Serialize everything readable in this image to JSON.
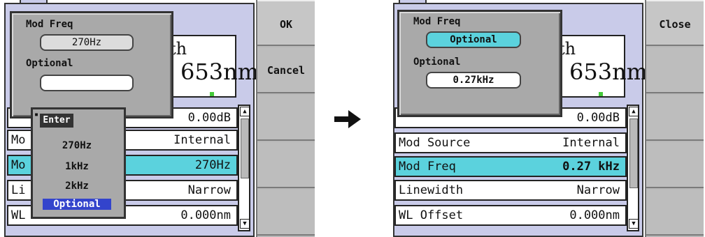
{
  "before": {
    "dialog": {
      "mod_freq_label": "Mod Freq",
      "mod_freq_value": "270Hz",
      "optional_label": "Optional",
      "optional_value": ""
    },
    "big_reading": "653nm",
    "partial_heading": "th",
    "level_value": "0.00dB",
    "rows": [
      {
        "label": "Mo",
        "value": "Internal"
      },
      {
        "label": "Mo",
        "value": "270Hz"
      },
      {
        "label": "Li",
        "value": "Narrow"
      },
      {
        "label": "WL",
        "value": "0.000nm"
      }
    ],
    "popup": {
      "title": "Enter",
      "options": [
        "270Hz",
        "1kHz",
        "2kHz",
        "Optional"
      ]
    },
    "softkeys": [
      "OK",
      "Cancel",
      "",
      "",
      ""
    ]
  },
  "after": {
    "dialog": {
      "mod_freq_label": "Mod Freq",
      "mod_freq_value": "Optional",
      "optional_label": "Optional",
      "optional_value": "0.27kHz"
    },
    "big_reading": "653nm",
    "partial_heading": "th",
    "level_value": "0.00dB",
    "rows": [
      {
        "label": "Mod Source",
        "value": "Internal"
      },
      {
        "label": "Mod Freq",
        "value": "0.27 kHz"
      },
      {
        "label": "Linewidth",
        "value": "Narrow"
      },
      {
        "label": "WL Offset",
        "value": "0.000nm"
      }
    ],
    "softkeys": [
      "Close",
      "",
      "",
      "",
      ""
    ]
  }
}
